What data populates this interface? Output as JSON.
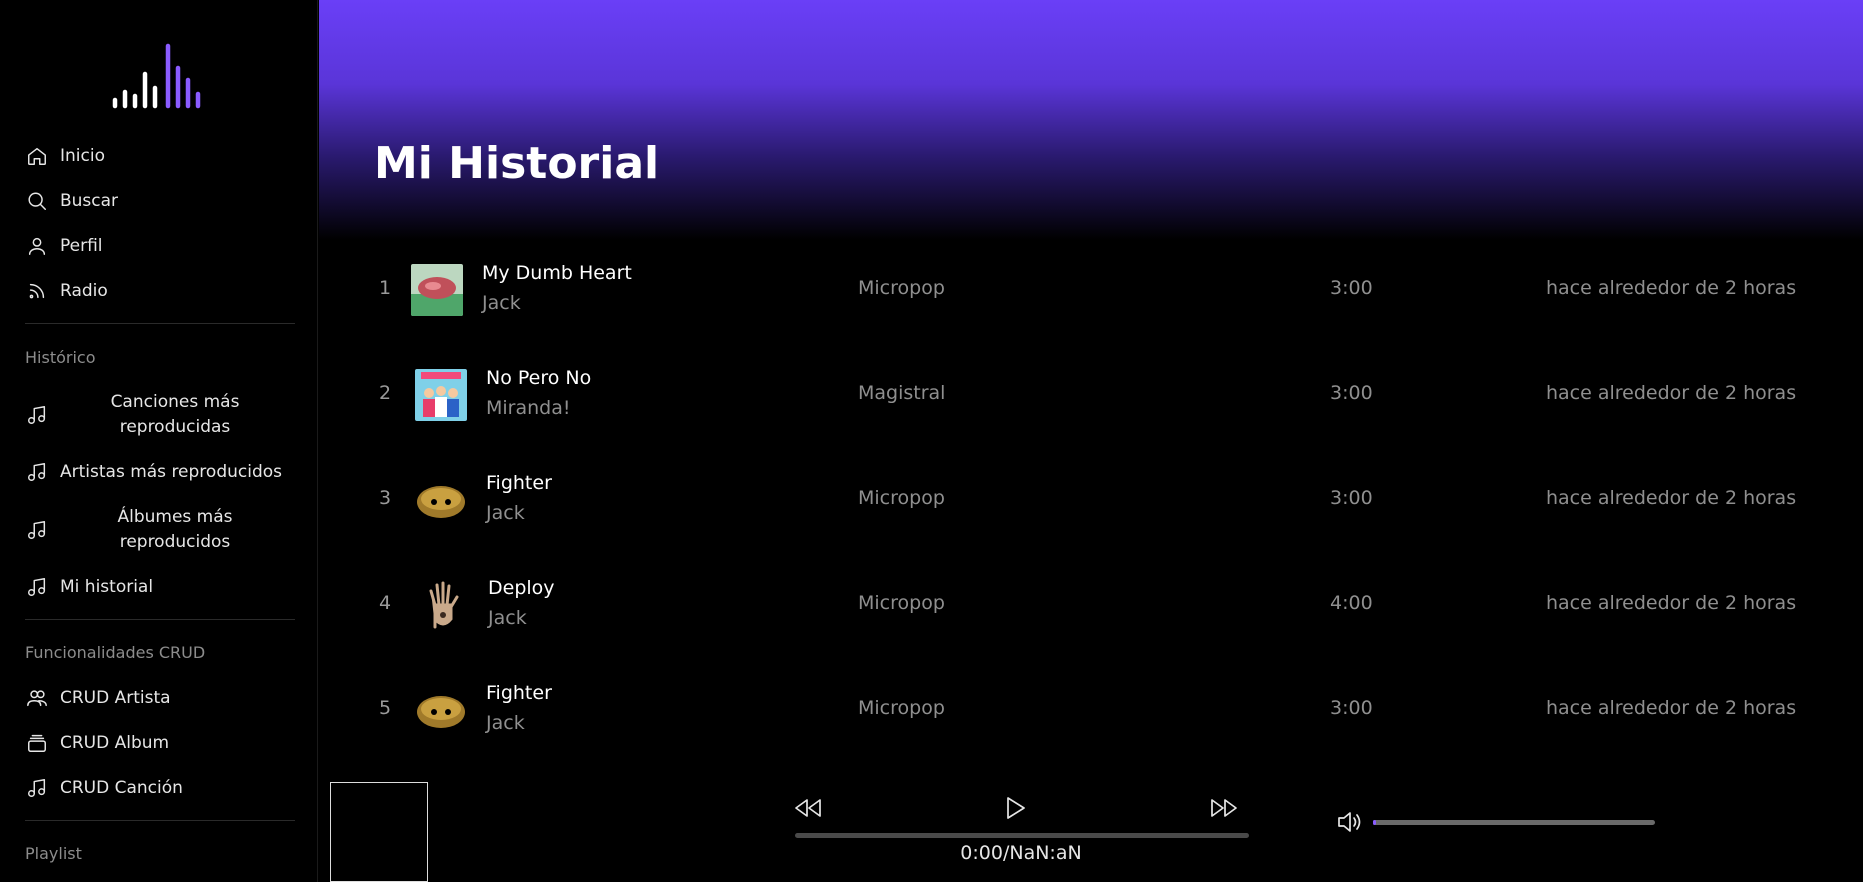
{
  "sidebar": {
    "nav": [
      {
        "label": "Inicio",
        "icon": "home-icon"
      },
      {
        "label": "Buscar",
        "icon": "search-icon"
      },
      {
        "label": "Perfil",
        "icon": "user-icon"
      },
      {
        "label": "Radio",
        "icon": "rss-icon"
      }
    ],
    "historico_title": "Histórico",
    "historico": [
      {
        "label": "Canciones más reproducidas",
        "icon": "music-note-icon"
      },
      {
        "label": "Artistas más reproducidos",
        "icon": "music-note-icon"
      },
      {
        "label": "Álbumes más reproducidos",
        "icon": "music-note-icon"
      },
      {
        "label": "Mi historial",
        "icon": "music-note-icon"
      }
    ],
    "crud_title": "Funcionalidades CRUD",
    "crud": [
      {
        "label": "CRUD Artista",
        "icon": "users-icon"
      },
      {
        "label": "CRUD Album",
        "icon": "album-stack-icon"
      },
      {
        "label": "CRUD Canción",
        "icon": "music-note-icon"
      }
    ],
    "playlist_title": "Playlist"
  },
  "main": {
    "title": "Mi Historial",
    "tracks": [
      {
        "num": "1",
        "title": "My Dumb Heart",
        "artist": "Jack",
        "album": "Micropop",
        "duration": "3:00",
        "played": "hace alrededor de 2 horas"
      },
      {
        "num": "2",
        "title": "No Pero No",
        "artist": "Miranda!",
        "album": "Magistral",
        "duration": "3:00",
        "played": "hace alrededor de 2 horas"
      },
      {
        "num": "3",
        "title": "Fighter",
        "artist": "Jack",
        "album": "Micropop",
        "duration": "3:00",
        "played": "hace alrededor de 2 horas"
      },
      {
        "num": "4",
        "title": "Deploy",
        "artist": "Jack",
        "album": "Micropop",
        "duration": "4:00",
        "played": "hace alrededor de 2 horas"
      },
      {
        "num": "5",
        "title": "Fighter",
        "artist": "Jack",
        "album": "Micropop",
        "duration": "3:00",
        "played": "hace alrededor de 2 horas"
      }
    ]
  },
  "player": {
    "time": "0:00/NaN:aN",
    "progress": 0,
    "volume": 0.01
  },
  "colors": {
    "accent": "#6a3ff7",
    "background": "#000000",
    "muted_text": "#8f8f8f"
  }
}
